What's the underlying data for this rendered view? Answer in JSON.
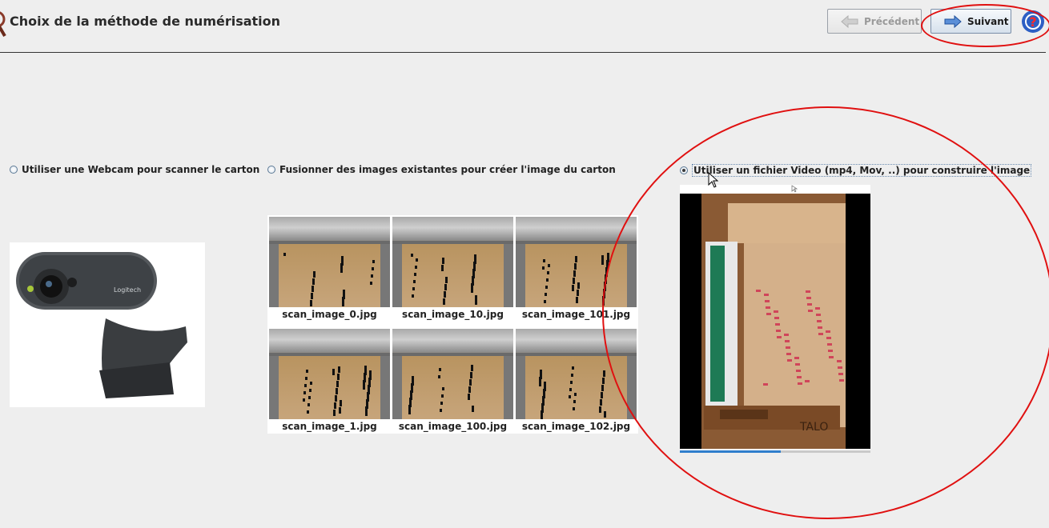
{
  "header": {
    "title": "Choix de la méthode de numérisation",
    "prev_label": "Précédent",
    "next_label": "Suivant",
    "prev_icon": "arrow-left-icon",
    "next_icon": "arrow-right-icon",
    "help_icon": "help-icon"
  },
  "options": {
    "webcam": {
      "label": "Utiliser une Webcam pour scanner le carton",
      "selected": false
    },
    "merge": {
      "label": "Fusionner des images existantes pour créer l'image du carton",
      "selected": false
    },
    "video": {
      "label": "Utiliser un fichier Video (mp4, Mov, ..) pour construire l'image",
      "selected": true
    }
  },
  "thumbnails": [
    "scan_image_0.jpg",
    "scan_image_10.jpg",
    "scan_image_101.jpg",
    "scan_image_1.jpg",
    "scan_image_100.jpg",
    "scan_image_102.jpg"
  ],
  "webcam_image": {
    "brand_text": "Logitech"
  },
  "video_preview": {
    "progress_fraction": 0.53,
    "stamp_text": "TALO"
  },
  "colors": {
    "annotation": "#e01010",
    "progress": "#2f7ecc",
    "accent_border": "#7a8ea8"
  }
}
